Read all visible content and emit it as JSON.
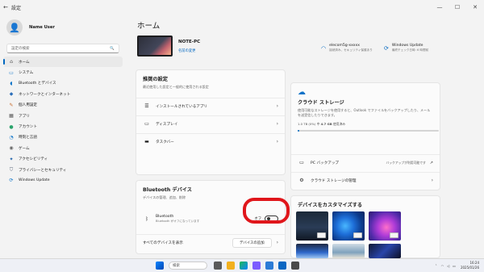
{
  "window": {
    "back": "←",
    "title": "設定",
    "min": "—",
    "max": "☐",
    "close": "✕"
  },
  "user": {
    "name": "Name User",
    "email": ""
  },
  "search": {
    "placeholder": "設定の検索",
    "icon": "search-icon"
  },
  "nav": [
    {
      "label": "ホーム",
      "icon": "home-icon"
    },
    {
      "label": "システム",
      "icon": "monitor-icon"
    },
    {
      "label": "Bluetooth とデバイス",
      "icon": "bluetooth-icon"
    },
    {
      "label": "ネットワークとインターネット",
      "icon": "wifi-icon"
    },
    {
      "label": "個人用設定",
      "icon": "brush-icon"
    },
    {
      "label": "アプリ",
      "icon": "apps-icon"
    },
    {
      "label": "アカウント",
      "icon": "person-icon"
    },
    {
      "label": "時刻と言語",
      "icon": "clock-icon"
    },
    {
      "label": "ゲーム",
      "icon": "gamepad-icon"
    },
    {
      "label": "アクセシビリティ",
      "icon": "accessibility-icon"
    },
    {
      "label": "プライバシーとセキュリティ",
      "icon": "shield-icon"
    },
    {
      "label": "Windows Update",
      "icon": "update-icon"
    }
  ],
  "main": {
    "title": "ホーム",
    "device": {
      "name": "NOTE-PC",
      "model": "",
      "rename": "名前の変更"
    },
    "wifi": {
      "title": "elecom5g-xxxxx",
      "subtitle": "接続済み、セキュリティ保護あり"
    },
    "update": {
      "title": "Windows Update",
      "subtitle": "最終チェック日時: 6 時間前"
    },
    "recommended": {
      "title": "推奨の設定",
      "subtitle": "最近使用した設定と一般的に使用される設定",
      "items": [
        "インストールされているアプリ",
        "ディスプレイ",
        "タスクバー"
      ]
    },
    "bluetooth": {
      "title": "Bluetooth デバイス",
      "subtitle": "デバイスの管理、追加、削除",
      "item_title": "Bluetooth",
      "item_sub": "Bluetooth がオフになっています",
      "toggle_state": "オフ",
      "view_all": "すべてのデバイスを表示",
      "add_device": "デバイスの追加"
    },
    "cloud": {
      "title": "クラウド ストレージ",
      "desc": "使用可能なストレージを使用すると、Outlook でファイルをバックアップしたり、メールを送受信したりできます。",
      "usage_used": "1.0 TB (0%) 中",
      "usage_amount": "4.7 GB",
      "usage_suffix": "使用済み",
      "progress": 0.01,
      "pc_backup": "PC バックアップ",
      "backup_status": "バックアップが利用可能です",
      "manage": "クラウド ストレージの管理"
    },
    "customize": {
      "title": "デバイスをカスタマイズする"
    }
  },
  "taskbar": {
    "search": "検索",
    "time": "16:24",
    "date": "2025/01/26"
  },
  "colors": {
    "accent": "#0067c0",
    "highlight_ring": "#e0161b"
  }
}
